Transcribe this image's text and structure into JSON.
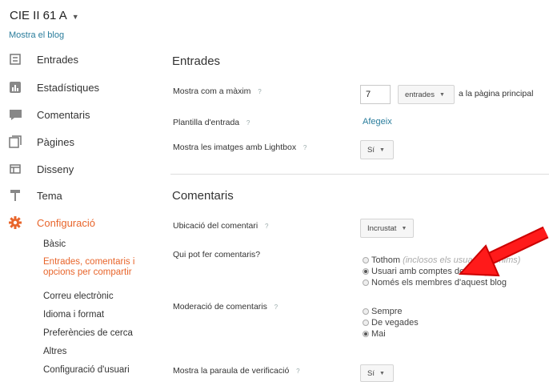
{
  "header": {
    "blog_name": "CIE II 61 A",
    "view_blog": "Mostra el blog"
  },
  "sidebar": {
    "items": [
      {
        "label": "Entrades",
        "icon": "posts-icon"
      },
      {
        "label": "Estadístiques",
        "icon": "stats-icon"
      },
      {
        "label": "Comentaris",
        "icon": "comments-icon"
      },
      {
        "label": "Pàgines",
        "icon": "pages-icon"
      },
      {
        "label": "Disseny",
        "icon": "layout-icon"
      },
      {
        "label": "Tema",
        "icon": "theme-icon"
      },
      {
        "label": "Configuració",
        "icon": "gear-icon"
      }
    ],
    "subitems": [
      "Bàsic",
      "Entrades, comentaris i",
      "opcions per compartir",
      "Correu electrònic",
      "Idioma i format",
      "Preferències de cerca",
      "Altres",
      "Configuració d'usuari"
    ],
    "accent_color": "#e8652b"
  },
  "entrades": {
    "title": "Entrades",
    "max_label": "Mostra com a màxim",
    "max_value": "7",
    "unit_select": "entrades",
    "suffix": "a la pàgina principal",
    "template_label": "Plantilla d'entrada",
    "template_link": "Afegeix",
    "lightbox_label": "Mostra les imatges amb Lightbox",
    "lightbox_value": "Sí"
  },
  "comentaris": {
    "title": "Comentaris",
    "location_label": "Ubicació del comentari",
    "location_value": "Incrustat",
    "who_label": "Qui pot fer comentaris?",
    "who_options": [
      {
        "label": "Tothom",
        "note": "(inclosos els usuaris anònims)",
        "checked": false
      },
      {
        "label": "Usuari amb comptes de Google",
        "checked": true
      },
      {
        "label": "Només els membres d'aquest blog",
        "checked": false
      }
    ],
    "moderation_label": "Moderació de comentaris",
    "moderation_options": [
      {
        "label": "Sempre",
        "checked": false
      },
      {
        "label": "De vegades",
        "checked": false
      },
      {
        "label": "Mai",
        "checked": true
      }
    ],
    "captcha_label": "Mostra la paraula de verificació",
    "captcha_value": "Sí"
  },
  "help_glyph": "?",
  "caret_glyph": "▼"
}
